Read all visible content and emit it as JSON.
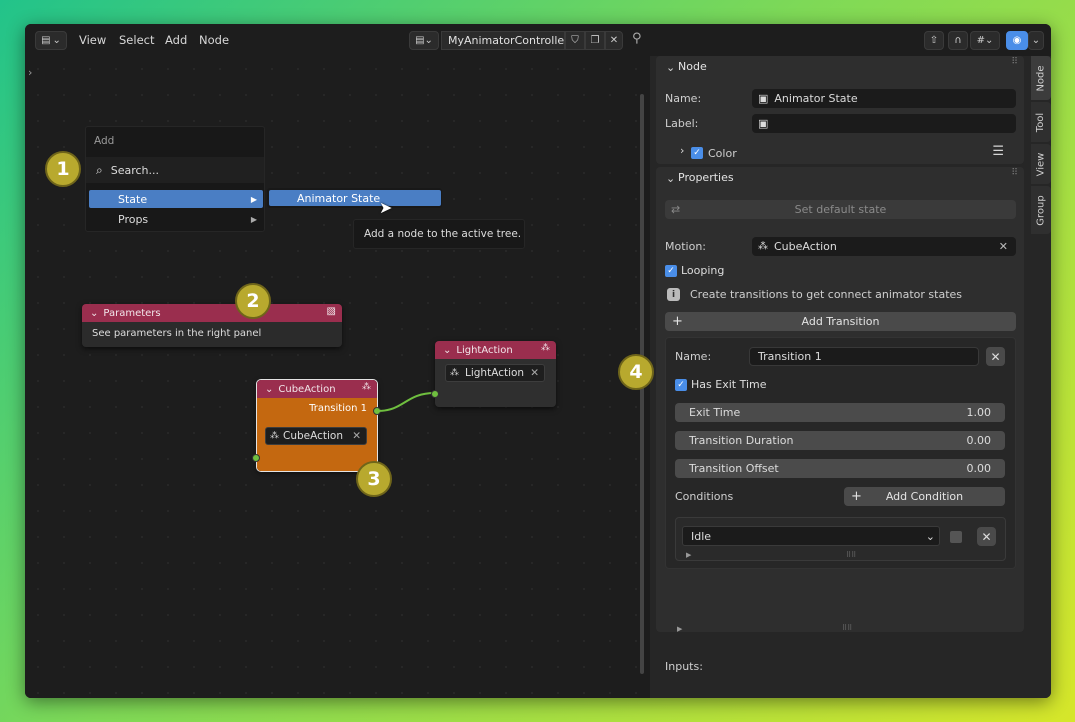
{
  "header": {
    "menus": [
      "View",
      "Select",
      "Add",
      "Node"
    ],
    "tree_name": "MyAnimatorController"
  },
  "add_menu": {
    "title": "Add",
    "search_label": "Search...",
    "items": [
      "State",
      "Props"
    ],
    "submenu_item": "Animator State",
    "tooltip": "Add a node to the active tree."
  },
  "badges": [
    "1",
    "2",
    "3",
    "4"
  ],
  "nodes": {
    "parameters": {
      "title": "Parameters",
      "text": "See parameters in the right panel"
    },
    "cube": {
      "title": "CubeAction",
      "output": "Transition 1",
      "field": "CubeAction"
    },
    "light": {
      "title": "LightAction",
      "field": "LightAction"
    }
  },
  "panel": {
    "tabs": [
      "Node",
      "Tool",
      "View",
      "Group"
    ],
    "node_section": {
      "title": "Node",
      "name_label": "Name:",
      "name_value": "Animator State",
      "label_label": "Label:",
      "label_value": "",
      "color_label": "Color"
    },
    "props_section": {
      "title": "Properties",
      "set_default": "Set default state",
      "motion_label": "Motion:",
      "motion_value": "CubeAction",
      "looping_label": "Looping",
      "info_text": "Create transitions to get connect animator states",
      "add_transition": "Add Transition"
    },
    "transition": {
      "name_label": "Name:",
      "name_value": "Transition 1",
      "has_exit_time": "Has Exit Time",
      "exit_time_label": "Exit Time",
      "exit_time_value": "1.00",
      "duration_label": "Transition Duration",
      "duration_value": "0.00",
      "offset_label": "Transition Offset",
      "offset_value": "0.00",
      "conditions_label": "Conditions",
      "add_condition": "Add Condition",
      "condition_value": "Idle"
    },
    "inputs_label": "Inputs:"
  },
  "colors": {
    "node_header": "#9a2e4e",
    "active_node": "#c46810",
    "selection": "#4a8ee8",
    "badge": "#b8a92e",
    "link": "#6fbf3f"
  }
}
